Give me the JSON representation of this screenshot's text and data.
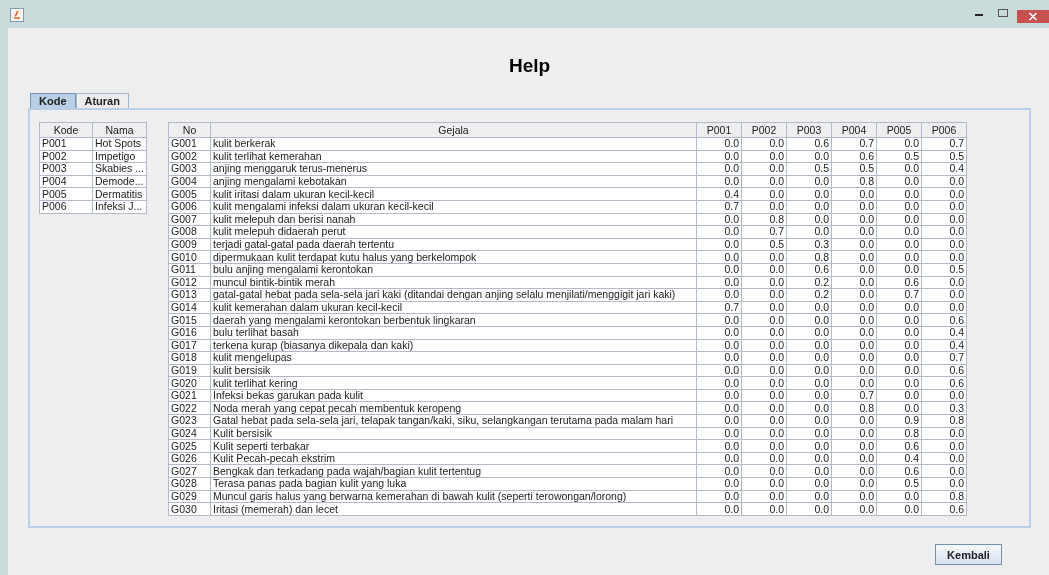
{
  "window": {
    "title": "Help"
  },
  "tabs": [
    {
      "label": "Kode",
      "selected": true
    },
    {
      "label": "Aturan",
      "selected": false
    }
  ],
  "kode_table": {
    "columns": [
      "Kode",
      "Nama"
    ],
    "rows": [
      {
        "kode": "P001",
        "nama": "Hot Spots"
      },
      {
        "kode": "P002",
        "nama": "Impetigo"
      },
      {
        "kode": "P003",
        "nama": "Skabies ..."
      },
      {
        "kode": "P004",
        "nama": "Demode..."
      },
      {
        "kode": "P005",
        "nama": "Dermatitis"
      },
      {
        "kode": "P006",
        "nama": "Infeksi J..."
      }
    ]
  },
  "gejala_table": {
    "columns": [
      "No",
      "Gejala",
      "P001",
      "P002",
      "P003",
      "P004",
      "P005",
      "P006"
    ],
    "rows": [
      {
        "no": "G001",
        "gejala": "kulit berkerak",
        "values": [
          "0.0",
          "0.0",
          "0.6",
          "0.7",
          "0.0",
          "0.7"
        ]
      },
      {
        "no": "G002",
        "gejala": "kulit terlihat kemerahan",
        "values": [
          "0.0",
          "0.0",
          "0.0",
          "0.6",
          "0.5",
          "0.5"
        ]
      },
      {
        "no": "G003",
        "gejala": "anjing menggaruk terus-menerus",
        "values": [
          "0.0",
          "0.0",
          "0.5",
          "0.5",
          "0.0",
          "0.4"
        ]
      },
      {
        "no": "G004",
        "gejala": "anjing mengalami kebotakan",
        "values": [
          "0.0",
          "0.0",
          "0.0",
          "0.8",
          "0.0",
          "0.0"
        ]
      },
      {
        "no": "G005",
        "gejala": "kulit iritasi dalam ukuran kecil-kecil",
        "values": [
          "0.4",
          "0.0",
          "0.0",
          "0.0",
          "0.0",
          "0.0"
        ]
      },
      {
        "no": "G006",
        "gejala": "kulit mengalami infeksi dalam ukuran kecil-kecil",
        "values": [
          "0.7",
          "0.0",
          "0.0",
          "0.0",
          "0.0",
          "0.0"
        ]
      },
      {
        "no": "G007",
        "gejala": "kulit melepuh dan berisi nanah",
        "values": [
          "0.0",
          "0.8",
          "0.0",
          "0.0",
          "0.0",
          "0.0"
        ]
      },
      {
        "no": "G008",
        "gejala": "kulit melepuh didaerah perut",
        "values": [
          "0.0",
          "0.7",
          "0.0",
          "0.0",
          "0.0",
          "0.0"
        ]
      },
      {
        "no": "G009",
        "gejala": "terjadi gatal-gatal pada daerah tertentu",
        "values": [
          "0.0",
          "0.5",
          "0.3",
          "0.0",
          "0.0",
          "0.0"
        ]
      },
      {
        "no": "G010",
        "gejala": "dipermukaan kulit terdapat kutu halus yang berkelompok",
        "values": [
          "0.0",
          "0.0",
          "0.8",
          "0.0",
          "0.0",
          "0.0"
        ]
      },
      {
        "no": "G011",
        "gejala": "bulu anjing mengalami kerontokan",
        "values": [
          "0.0",
          "0.0",
          "0.6",
          "0.0",
          "0.0",
          "0.5"
        ]
      },
      {
        "no": "G012",
        "gejala": "muncul bintik-bintik merah",
        "values": [
          "0.0",
          "0.0",
          "0.2",
          "0.0",
          "0.6",
          "0.0"
        ]
      },
      {
        "no": "G013",
        "gejala": "gatal-gatal hebat pada sela-sela jari kaki (ditandai dengan anjing selalu menjilati/menggigit jari kaki)",
        "values": [
          "0.0",
          "0.0",
          "0.2",
          "0.0",
          "0.7",
          "0.0"
        ]
      },
      {
        "no": "G014",
        "gejala": "kulit kemerahan dalam ukuran kecil-kecil",
        "values": [
          "0.7",
          "0.0",
          "0.0",
          "0.0",
          "0.0",
          "0.0"
        ]
      },
      {
        "no": "G015",
        "gejala": "daerah yang mengalami kerontokan berbentuk lingkaran",
        "values": [
          "0.0",
          "0.0",
          "0.0",
          "0.0",
          "0.0",
          "0.6"
        ]
      },
      {
        "no": "G016",
        "gejala": "bulu terlihat basah",
        "values": [
          "0.0",
          "0.0",
          "0.0",
          "0.0",
          "0.0",
          "0.4"
        ]
      },
      {
        "no": "G017",
        "gejala": "terkena kurap (biasanya dikepala dan kaki)",
        "values": [
          "0.0",
          "0.0",
          "0.0",
          "0.0",
          "0.0",
          "0.4"
        ]
      },
      {
        "no": "G018",
        "gejala": "kulit mengelupas",
        "values": [
          "0.0",
          "0.0",
          "0.0",
          "0.0",
          "0.0",
          "0.7"
        ]
      },
      {
        "no": "G019",
        "gejala": "kulit bersisik",
        "values": [
          "0.0",
          "0.0",
          "0.0",
          "0.0",
          "0.0",
          "0.6"
        ]
      },
      {
        "no": "G020",
        "gejala": "kulit terlihat kering",
        "values": [
          "0.0",
          "0.0",
          "0.0",
          "0.0",
          "0.0",
          "0.6"
        ]
      },
      {
        "no": "G021",
        "gejala": "Infeksi bekas garukan pada kulit",
        "values": [
          "0.0",
          "0.0",
          "0.0",
          "0.7",
          "0.0",
          "0.0"
        ]
      },
      {
        "no": "G022",
        "gejala": "Noda merah yang cepat pecah membentuk keropeng",
        "values": [
          "0.0",
          "0.0",
          "0.0",
          "0.8",
          "0.0",
          "0.3"
        ]
      },
      {
        "no": "G023",
        "gejala": "Gatal hebat pada sela-sela jari, telapak tangan/kaki, siku, selangkangan terutama pada malam hari",
        "values": [
          "0.0",
          "0.0",
          "0.0",
          "0.0",
          "0.9",
          "0.8"
        ]
      },
      {
        "no": "G024",
        "gejala": "Kulit bersisik",
        "values": [
          "0.0",
          "0.0",
          "0.0",
          "0.0",
          "0.8",
          "0.0"
        ]
      },
      {
        "no": "G025",
        "gejala": "Kulit seperti terbakar",
        "values": [
          "0.0",
          "0.0",
          "0.0",
          "0.0",
          "0.6",
          "0.0"
        ]
      },
      {
        "no": "G026",
        "gejala": "Kulit Pecah-pecah ekstrim",
        "values": [
          "0.0",
          "0.0",
          "0.0",
          "0.0",
          "0.4",
          "0.0"
        ]
      },
      {
        "no": "G027",
        "gejala": "Bengkak dan terkadang pada wajah/bagian kulit tertentug",
        "values": [
          "0.0",
          "0.0",
          "0.0",
          "0.0",
          "0.6",
          "0.0"
        ]
      },
      {
        "no": "G028",
        "gejala": "Terasa panas pada bagian kulit yang luka",
        "values": [
          "0.0",
          "0.0",
          "0.0",
          "0.0",
          "0.5",
          "0.0"
        ]
      },
      {
        "no": "G029",
        "gejala": "Muncul garis halus yang berwarna kemerahan di bawah kulit (seperti terowongan/lorong)",
        "values": [
          "0.0",
          "0.0",
          "0.0",
          "0.0",
          "0.0",
          "0.8"
        ]
      },
      {
        "no": "G030",
        "gejala": "Iritasi (memerah) dan lecet",
        "values": [
          "0.0",
          "0.0",
          "0.0",
          "0.0",
          "0.0",
          "0.6"
        ]
      }
    ]
  },
  "buttons": [
    "Kembali"
  ]
}
